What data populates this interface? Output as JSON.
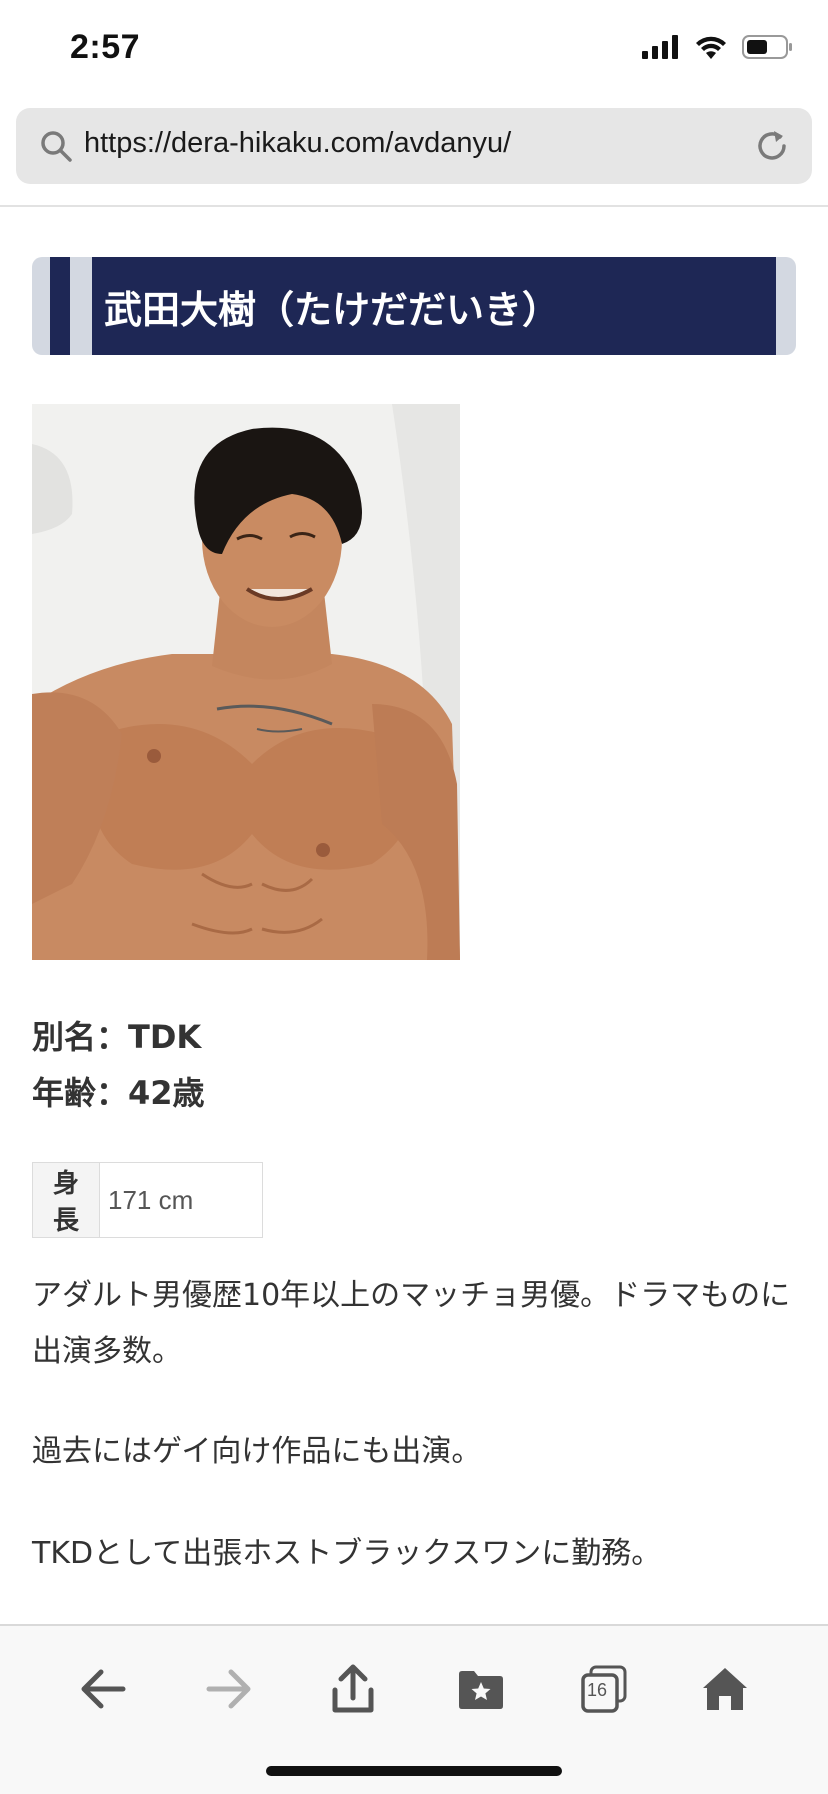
{
  "status_bar": {
    "time": "2:57"
  },
  "browser": {
    "url": "https://dera-hikaku.com/avdanyu/",
    "tab_count": "16"
  },
  "profile": {
    "heading": "武田大樹（たけだだいき）",
    "photo_alt": "武田大樹",
    "alias_line": "別名：TDK",
    "age_line": "年齢：42歳",
    "height_label": "身長",
    "height_value": "171 cm",
    "paragraphs": [
      "アダルト男優歴10年以上のマッチョ男優。ドラマものに出演多数。",
      "過去にはゲイ向け作品にも出演。",
      "TKDとして出張ホストブラックスワンに勤務。"
    ]
  },
  "colors": {
    "heading_bg": "#1e2755",
    "heading_frame": "#d3d8e1",
    "toolbar_icon": "#555555",
    "toolbar_icon_disabled": "#b0b0b0"
  },
  "icons": {
    "toolbar": [
      "back-arrow-icon",
      "forward-arrow-icon",
      "share-icon",
      "bookmarks-icon",
      "tabs-icon",
      "home-icon"
    ]
  }
}
